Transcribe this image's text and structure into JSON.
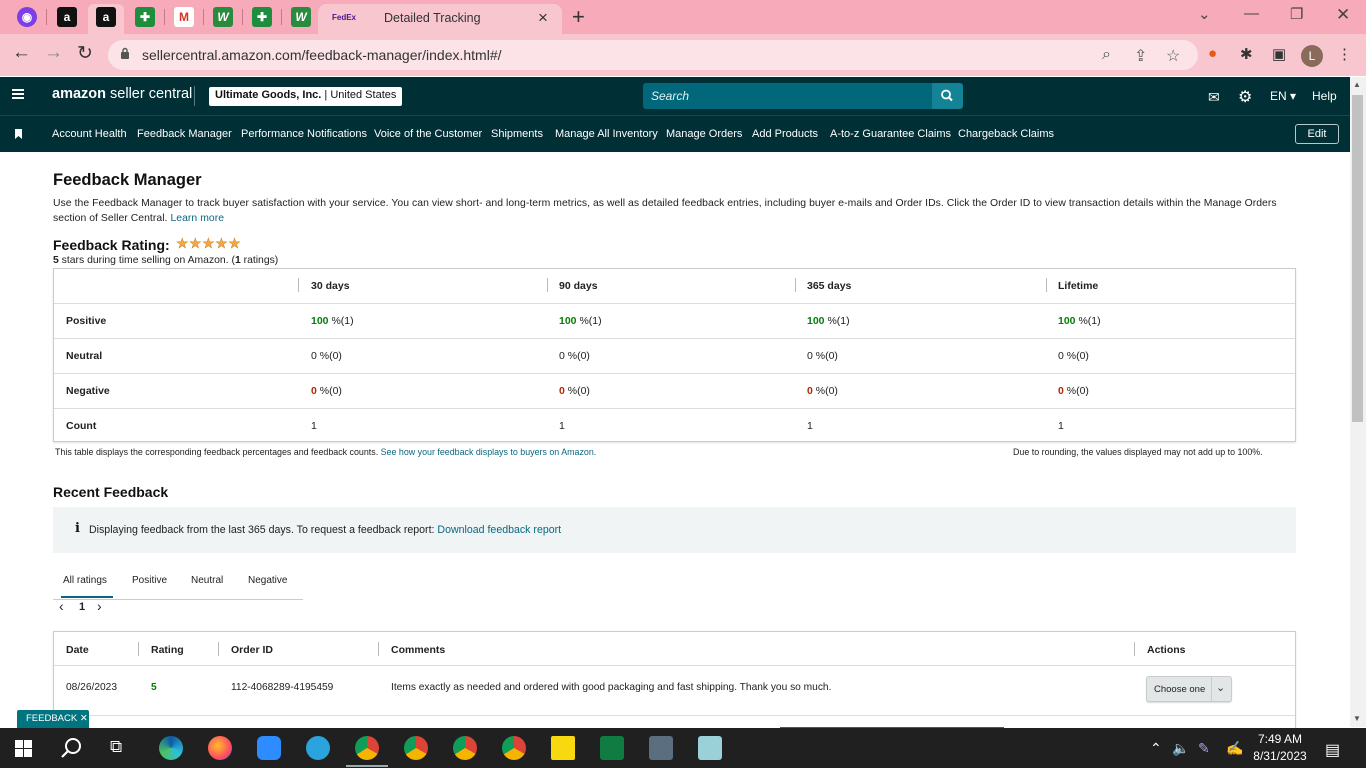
{
  "browser": {
    "active_tab_title": "Detailed Tracking",
    "active_tab_favicon": "FedEx",
    "url": "sellercentral.amazon.com/feedback-manager/index.html#/",
    "pinned_tabs": [
      "messenger-icon",
      "amazon-icon",
      "amazon-icon",
      "sheets-icon",
      "gmail-icon",
      "app-w-icon",
      "sheets-icon",
      "app-w-icon"
    ],
    "profile_initial": "L"
  },
  "header": {
    "logo_brand": "amazon",
    "logo_product": " seller central",
    "store_name": "Ultimate Goods, Inc.",
    "store_region": " | United States",
    "search_placeholder": "Search",
    "language": "EN",
    "help": "Help"
  },
  "nav": {
    "items": [
      "Account Health",
      "Feedback Manager",
      "Performance Notifications",
      "Voice of the Customer",
      "Shipments",
      "Manage All Inventory",
      "Manage Orders",
      "Add Products",
      "A-to-z Guarantee Claims",
      "Chargeback Claims"
    ],
    "edit": "Edit"
  },
  "page": {
    "title": "Feedback Manager",
    "intro": "Use the Feedback Manager to track buyer satisfaction with your service. You can view short- and long-term metrics, as well as detailed feedback entries, including buyer e-mails and Order IDs. Click the Order ID to view transaction details within the Manage Orders section of Seller Central.",
    "learn_more": "Learn more",
    "rating_title": "Feedback Rating:",
    "stars": "★★★★★",
    "rating_value": 5,
    "rating_sub_bold": "5",
    "rating_sub": " stars during time selling on Amazon. (",
    "rating_sub_count": "1",
    "rating_sub_end": " ratings)"
  },
  "metrics": {
    "columns": [
      "30 days",
      "90 days",
      "365 days",
      "Lifetime"
    ],
    "rows": [
      {
        "label": "Positive",
        "pct": "100",
        "rest": " %(1)"
      },
      {
        "label": "Neutral",
        "pct": "0",
        "rest": " %(0)"
      },
      {
        "label": "Negative",
        "pct": "0",
        "rest": " %(0)"
      },
      {
        "label": "Count",
        "pct": "",
        "rest": "1"
      }
    ],
    "note": "This table displays the corresponding feedback percentages and feedback counts.",
    "note_link": "See how your feedback displays to buyers on Amazon.",
    "note_right": "Due to rounding, the values displayed may not add up to 100%."
  },
  "recent": {
    "title": "Recent Feedback",
    "info_icon": "i",
    "info_text": "Displaying feedback from the last 365 days. To request a feedback report: ",
    "info_link": "Download feedback report",
    "tabs": [
      "All ratings",
      "Positive",
      "Neutral",
      "Negative"
    ],
    "active_tab": "All ratings",
    "pager_prev": "‹",
    "pager_page": "1",
    "pager_next": "›",
    "columns": [
      "Date",
      "Rating",
      "Order ID",
      "Comments",
      "Actions"
    ],
    "rows": [
      {
        "date": "08/26/2023",
        "rating": "5",
        "order_id": "112-4068289-4195459",
        "comment": "Items exactly as needed and ordered with good packaging and fast shipping. Thank you so much.",
        "action": "Choose one"
      }
    ]
  },
  "feedback_tab": "FEEDBACK ✕",
  "taskbar": {
    "time": "7:49 AM",
    "date": "8/31/2023"
  },
  "colors": {
    "header_bg": "#002f36",
    "link": "#0a6780",
    "positive": "#067d06",
    "negative": "#b12704",
    "star": "#f3a847",
    "tabbar_bg": "#f7aab9"
  }
}
